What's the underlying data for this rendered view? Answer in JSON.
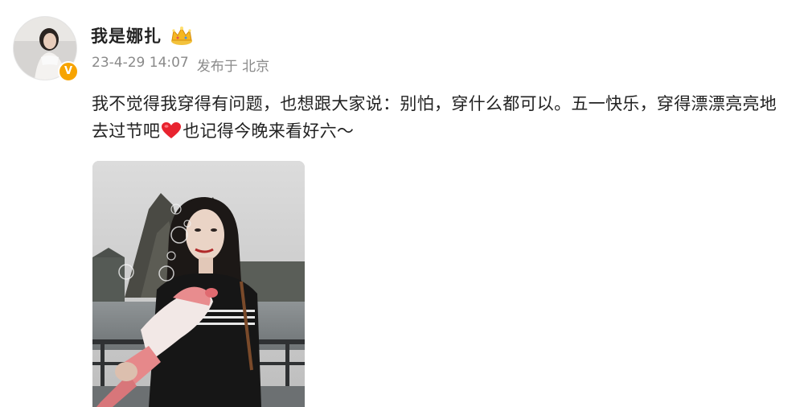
{
  "post": {
    "author": {
      "name": "我是娜扎",
      "verified_badge_glyph": "V",
      "badge_icon": "crown-icon",
      "avatar_icon": "avatar-photo"
    },
    "meta": {
      "timestamp": "23-4-29 14:07",
      "location": "发布于 北京"
    },
    "content": {
      "text_before_emoji": "我不觉得我穿得有问题，也想跟大家说：别怕，穿什么都可以。五一快乐，穿得漂漂亮亮地去过节吧",
      "emoji": "heart-icon",
      "text_after_emoji": "也记得今晚来看好六～"
    },
    "image": {
      "icon": "photo-woman-with-bubble-gun"
    },
    "colors": {
      "text": "#222222",
      "meta": "#8a8a8a",
      "verified": "#f7a400",
      "heart": "#e8232f"
    }
  }
}
